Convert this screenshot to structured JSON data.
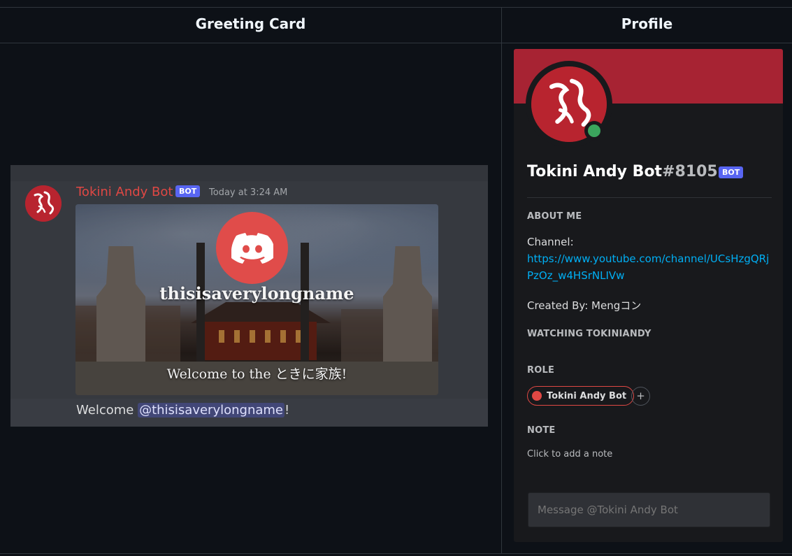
{
  "headers": {
    "greeting_card": "Greeting Card",
    "profile": "Profile"
  },
  "message": {
    "author": "Tokini Andy Bot",
    "badge": "BOT",
    "timestamp": "Today at 3:24 AM",
    "card": {
      "username": "thisisaverylongname",
      "welcome": "Welcome to the ときに家族!"
    },
    "text_prefix": "Welcome ",
    "mention": "@thisisaverylongname",
    "text_suffix": "!"
  },
  "profile": {
    "name": "Tokini Andy Bot",
    "discriminator": "#8105",
    "badge": "BOT",
    "about_title": "ABOUT ME",
    "about_channel_label": "Channel:",
    "about_channel_link": "https://www.youtube.com/channel/UCsHzgQRjPzOz_w4HSrNLIVw",
    "created_by": "Created By: Mengコン",
    "activity": "WATCHING TOKINIANDY",
    "role_title": "ROLE",
    "role_name": "Tokini Andy Bot",
    "note_title": "NOTE",
    "note_placeholder": "Click to add a note",
    "message_placeholder": "Message @Tokini Andy Bot"
  },
  "colors": {
    "accent_red": "#e04844",
    "banner": "#a72333",
    "bot_badge": "#5865f2",
    "online": "#3ba55d",
    "link": "#00aff4"
  },
  "icons": {
    "avatar": "tokini-andy-logo",
    "card_center": "discord-logo-icon",
    "add_role": "plus-icon"
  }
}
